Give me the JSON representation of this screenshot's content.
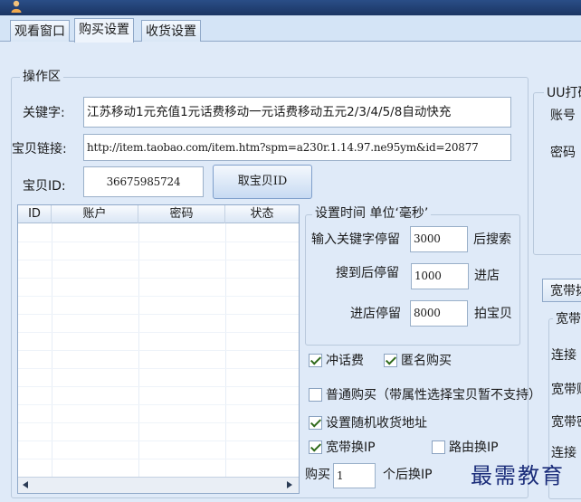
{
  "tabs": [
    {
      "label": "观看窗口"
    },
    {
      "label": "购买设置"
    },
    {
      "label": "收货设置"
    }
  ],
  "operation": {
    "group_title": "操作区",
    "keyword_label": "关键字:",
    "keyword_value": "江苏移动1元充值1元话费移动一元话费移动五元2/3/4/5/8自动快充",
    "link_label": "宝贝链接:",
    "link_value": "http://item.taobao.com/item.htm?spm=a230r.1.14.97.ne95ym&id=20877",
    "id_label": "宝贝ID:",
    "id_value": "36675985724",
    "get_id_button": "取宝贝ID"
  },
  "table": {
    "columns": [
      "ID",
      "账户",
      "密码",
      "状态"
    ]
  },
  "timing": {
    "group_title": "设置时间 单位‘毫秒’",
    "search_delay_label": "输入关键字停留",
    "search_delay_value": "3000",
    "search_delay_suffix": "后搜索",
    "found_delay_label": "搜到后停留",
    "found_delay_value": "1000",
    "found_delay_suffix": "进店",
    "store_delay_label": "进店停留",
    "store_delay_value": "8000",
    "store_delay_suffix": "拍宝贝"
  },
  "options": {
    "recharge": {
      "label": "冲话费",
      "checked": true
    },
    "anonymous": {
      "label": "匿名购买",
      "checked": true
    },
    "normal": {
      "label": "普通购买（带属性选择宝贝暂不支持）",
      "checked": false
    },
    "random_address": {
      "label": "设置随机收货地址",
      "checked": true
    },
    "broadband_ip": {
      "label": "宽带换IP",
      "checked": true
    },
    "router_ip": {
      "label": "路由换IP",
      "checked": false
    },
    "buy_label": "购买",
    "buy_value": "1",
    "buy_suffix": "个后换IP"
  },
  "right_panel": {
    "group_title": "UU打码",
    "account_label": "账号",
    "password_label": "密码"
  },
  "broadband": {
    "tab_label": "宽带拨",
    "group_title": "宽带",
    "items": [
      "连接",
      "宽带账",
      "宽带密",
      "连接"
    ]
  },
  "watermark": "最需教育"
}
